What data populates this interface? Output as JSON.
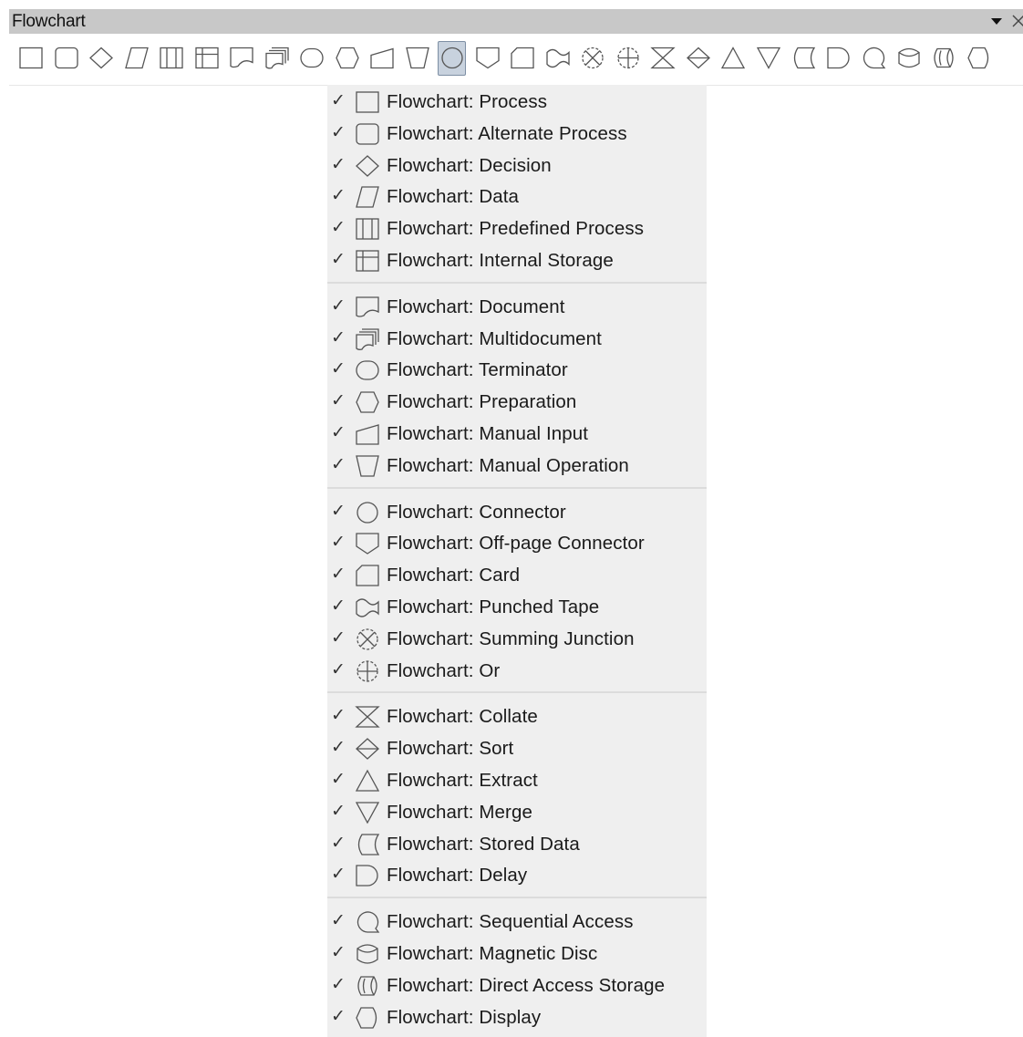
{
  "panel": {
    "title": "Flowchart"
  },
  "toolbar": {
    "active_index": 12,
    "buttons": [
      {
        "name": "process",
        "icon": "process-icon"
      },
      {
        "name": "alternate-process",
        "icon": "alternate-process-icon"
      },
      {
        "name": "decision",
        "icon": "decision-icon"
      },
      {
        "name": "data",
        "icon": "data-icon"
      },
      {
        "name": "predefined-process",
        "icon": "predefined-process-icon"
      },
      {
        "name": "internal-storage",
        "icon": "internal-storage-icon"
      },
      {
        "name": "document",
        "icon": "document-icon"
      },
      {
        "name": "multidocument",
        "icon": "multidocument-icon"
      },
      {
        "name": "terminator",
        "icon": "terminator-icon"
      },
      {
        "name": "preparation",
        "icon": "preparation-icon"
      },
      {
        "name": "manual-input",
        "icon": "manual-input-icon"
      },
      {
        "name": "manual-operation",
        "icon": "manual-operation-icon"
      },
      {
        "name": "connector",
        "icon": "connector-icon"
      },
      {
        "name": "off-page-connector",
        "icon": "off-page-connector-icon"
      },
      {
        "name": "card",
        "icon": "card-icon"
      },
      {
        "name": "punched-tape",
        "icon": "punched-tape-icon"
      },
      {
        "name": "summing-junction",
        "icon": "summing-junction-icon"
      },
      {
        "name": "or",
        "icon": "or-icon"
      },
      {
        "name": "collate",
        "icon": "collate-icon"
      },
      {
        "name": "sort",
        "icon": "sort-icon"
      },
      {
        "name": "extract",
        "icon": "extract-icon"
      },
      {
        "name": "merge",
        "icon": "merge-icon"
      },
      {
        "name": "stored-data",
        "icon": "stored-data-icon"
      },
      {
        "name": "delay",
        "icon": "delay-icon"
      },
      {
        "name": "sequential-access",
        "icon": "sequential-access-icon"
      },
      {
        "name": "magnetic-disc",
        "icon": "magnetic-disc-icon"
      },
      {
        "name": "direct-access-storage",
        "icon": "direct-access-storage-icon"
      },
      {
        "name": "display",
        "icon": "display-icon"
      }
    ]
  },
  "menu": {
    "check_mark": "✓",
    "items": [
      {
        "label": "Flowchart: Process",
        "icon": "process-icon",
        "checked": true
      },
      {
        "label": "Flowchart: Alternate Process",
        "icon": "alternate-process-icon",
        "checked": true
      },
      {
        "label": "Flowchart: Decision",
        "icon": "decision-icon",
        "checked": true
      },
      {
        "label": "Flowchart: Data",
        "icon": "data-icon",
        "checked": true
      },
      {
        "label": "Flowchart: Predefined Process",
        "icon": "predefined-process-icon",
        "checked": true
      },
      {
        "label": "Flowchart: Internal Storage",
        "icon": "internal-storage-icon",
        "checked": true
      },
      {
        "label": "Flowchart: Document",
        "icon": "document-icon",
        "checked": true
      },
      {
        "label": "Flowchart: Multidocument",
        "icon": "multidocument-icon",
        "checked": true
      },
      {
        "label": "Flowchart: Terminator",
        "icon": "terminator-icon",
        "checked": true
      },
      {
        "label": "Flowchart: Preparation",
        "icon": "preparation-icon",
        "checked": true
      },
      {
        "label": "Flowchart: Manual Input",
        "icon": "manual-input-icon",
        "checked": true
      },
      {
        "label": "Flowchart: Manual Operation",
        "icon": "manual-operation-icon",
        "checked": true
      },
      {
        "label": "Flowchart: Connector",
        "icon": "connector-icon",
        "checked": true
      },
      {
        "label": "Flowchart: Off-page Connector",
        "icon": "off-page-connector-icon",
        "checked": true
      },
      {
        "label": "Flowchart: Card",
        "icon": "card-icon",
        "checked": true
      },
      {
        "label": "Flowchart: Punched Tape",
        "icon": "punched-tape-icon",
        "checked": true
      },
      {
        "label": "Flowchart: Summing Junction",
        "icon": "summing-junction-icon",
        "checked": true
      },
      {
        "label": "Flowchart: Or",
        "icon": "or-icon",
        "checked": true
      },
      {
        "label": "Flowchart: Collate",
        "icon": "collate-icon",
        "checked": true
      },
      {
        "label": "Flowchart: Sort",
        "icon": "sort-icon",
        "checked": true
      },
      {
        "label": "Flowchart: Extract",
        "icon": "extract-icon",
        "checked": true
      },
      {
        "label": "Flowchart: Merge",
        "icon": "merge-icon",
        "checked": true
      },
      {
        "label": "Flowchart: Stored Data",
        "icon": "stored-data-icon",
        "checked": true
      },
      {
        "label": "Flowchart: Delay",
        "icon": "delay-icon",
        "checked": true
      },
      {
        "label": "Flowchart: Sequential Access",
        "icon": "sequential-access-icon",
        "checked": true
      },
      {
        "label": "Flowchart: Magnetic Disc",
        "icon": "magnetic-disc-icon",
        "checked": true
      },
      {
        "label": "Flowchart: Direct Access Storage",
        "icon": "direct-access-storage-icon",
        "checked": true
      },
      {
        "label": "Flowchart: Display",
        "icon": "display-icon",
        "checked": true
      }
    ]
  },
  "colors": {
    "titlebar_bg": "#c8c8c8",
    "menu_bg": "#efefef",
    "active_button_bg": "#c8d2de",
    "icon_stroke": "#555555"
  }
}
